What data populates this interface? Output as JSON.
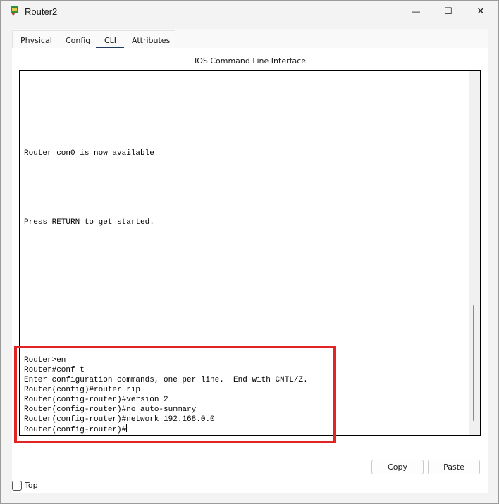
{
  "window": {
    "title": "Router2",
    "minimize_glyph": "—",
    "maximize_glyph": "☐",
    "close_glyph": "✕"
  },
  "tabs": [
    {
      "label": "Physical"
    },
    {
      "label": "Config"
    },
    {
      "label": "CLI",
      "selected": true
    },
    {
      "label": "Attributes"
    }
  ],
  "cli": {
    "section_title": "IOS Command Line Interface",
    "lines": [
      "Router con0 is now available",
      "Press RETURN to get started.",
      "Router>en",
      "Router#conf t",
      "Enter configuration commands, one per line.  End with CNTL/Z.",
      "Router(config)#router rip",
      "Router(config-router)#version 2",
      "Router(config-router)#no auto-summary",
      "Router(config-router)#network 192.168.0.0",
      "Router(config-router)#"
    ]
  },
  "buttons": {
    "copy": "Copy",
    "paste": "Paste"
  },
  "footer": {
    "top_label": "Top",
    "top_checked": false
  },
  "colors": {
    "highlight": "#e32424",
    "tab_underline": "#1e3a5f"
  }
}
